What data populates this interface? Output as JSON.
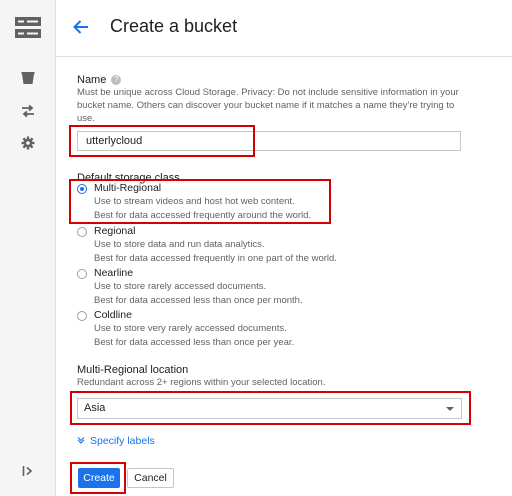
{
  "sidebar": {
    "icons": [
      "storage-icon",
      "bucket-icon",
      "transfer-icon",
      "settings-icon",
      "collapse-icon"
    ]
  },
  "header": {
    "title": "Create a bucket",
    "back_icon": "arrow-back-icon"
  },
  "name_section": {
    "label": "Name",
    "description": "Must be unique across Cloud Storage. Privacy: Do not include sensitive information in your bucket name. Others can discover your bucket name if it matches a name they're trying to use.",
    "value": "utterlycloud"
  },
  "storage_class": {
    "label": "Default storage class",
    "options": [
      {
        "label": "Multi-Regional",
        "lines": [
          "Use to stream videos and host hot web content.",
          "Best for data accessed frequently around the world."
        ],
        "selected": true
      },
      {
        "label": "Regional",
        "lines": [
          "Use to store data and run data analytics.",
          "Best for data accessed frequently in one part of the world."
        ],
        "selected": false
      },
      {
        "label": "Nearline",
        "lines": [
          "Use to store rarely accessed documents.",
          "Best for data accessed less than once per month."
        ],
        "selected": false
      },
      {
        "label": "Coldline",
        "lines": [
          "Use to store very rarely accessed documents.",
          "Best for data accessed less than once per year."
        ],
        "selected": false
      }
    ]
  },
  "location": {
    "label": "Multi-Regional location",
    "description": "Redundant across 2+ regions within your selected location.",
    "value": "Asia"
  },
  "labels_link": "Specify labels",
  "buttons": {
    "create": "Create",
    "cancel": "Cancel"
  },
  "colors": {
    "accent": "#1a73e8",
    "highlight": "#d50000"
  }
}
